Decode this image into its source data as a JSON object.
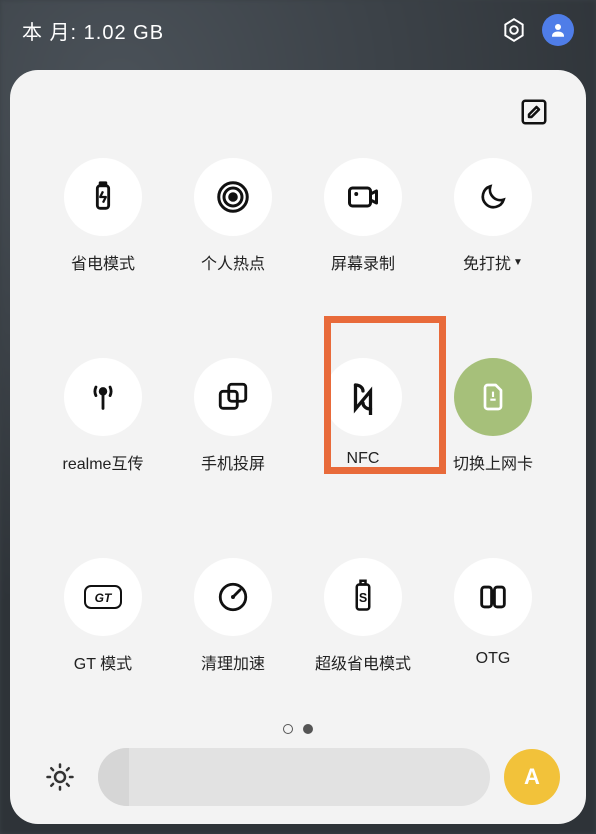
{
  "status": {
    "data_label": "本 月: 1.02 GB"
  },
  "tiles": [
    {
      "id": "battery-saver",
      "label": "省电模式",
      "icon": "battery-icon"
    },
    {
      "id": "hotspot",
      "label": "个人热点",
      "icon": "hotspot-icon"
    },
    {
      "id": "screen-record",
      "label": "屏幕录制",
      "icon": "screen-record-icon"
    },
    {
      "id": "dnd",
      "label": "免打扰",
      "icon": "moon-icon",
      "has_caret": true
    },
    {
      "id": "realme-share",
      "label": "realme互传",
      "icon": "antenna-icon"
    },
    {
      "id": "cast",
      "label": "手机投屏",
      "icon": "cast-icon"
    },
    {
      "id": "nfc",
      "label": "NFC",
      "icon": "nfc-icon",
      "highlighted": true
    },
    {
      "id": "sim-switch",
      "label": "切换上网卡",
      "icon": "sim-icon",
      "on": true
    },
    {
      "id": "gt-mode",
      "label": "GT 模式",
      "icon": "gt-icon"
    },
    {
      "id": "cleanup",
      "label": "清理加速",
      "icon": "gauge-icon"
    },
    {
      "id": "super-saver",
      "label": "超级省电模式",
      "icon": "battery5-icon"
    },
    {
      "id": "otg",
      "label": "OTG",
      "icon": "otg-icon"
    }
  ],
  "pager": {
    "current": 1,
    "total": 2
  },
  "brightness": {
    "auto_label": "A",
    "value_pct": 8
  },
  "colors": {
    "highlight": "#e86a3a",
    "tile_on": "#a6c07a",
    "auto_btn": "#f2c23a"
  }
}
